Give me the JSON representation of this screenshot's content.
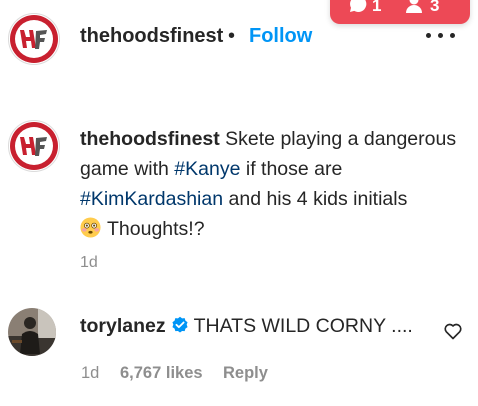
{
  "notification": {
    "comment_count": "1",
    "follow_count": "3",
    "color": "#ed4956"
  },
  "post": {
    "username": "thehoodsfinest",
    "separator": "•",
    "follow_label": "Follow",
    "more_icon": "more-options-icon",
    "avatar_initials": "HF"
  },
  "caption": {
    "username": "thehoodsfinest",
    "text_1": " Skete playing a dangerous game with ",
    "tag_1": "#Kanye",
    "text_2": " if those are ",
    "tag_2": "#KimKardashian",
    "text_3": " and his 4 kids initials ",
    "emoji": "flushed-face-emoji",
    "text_4": "Thoughts!?",
    "timestamp": "1d"
  },
  "comment": {
    "username": "torylanez",
    "verified_icon": "verified-badge-icon",
    "text": "THATS WILD CORNY ....",
    "timestamp": "1d",
    "likes": "6,767 likes",
    "reply_label": "Reply",
    "like_icon": "heart-icon"
  },
  "colors": {
    "link": "#0095f6",
    "hashtag": "#00376b",
    "muted": "#8e8e8e",
    "text": "#262626"
  }
}
